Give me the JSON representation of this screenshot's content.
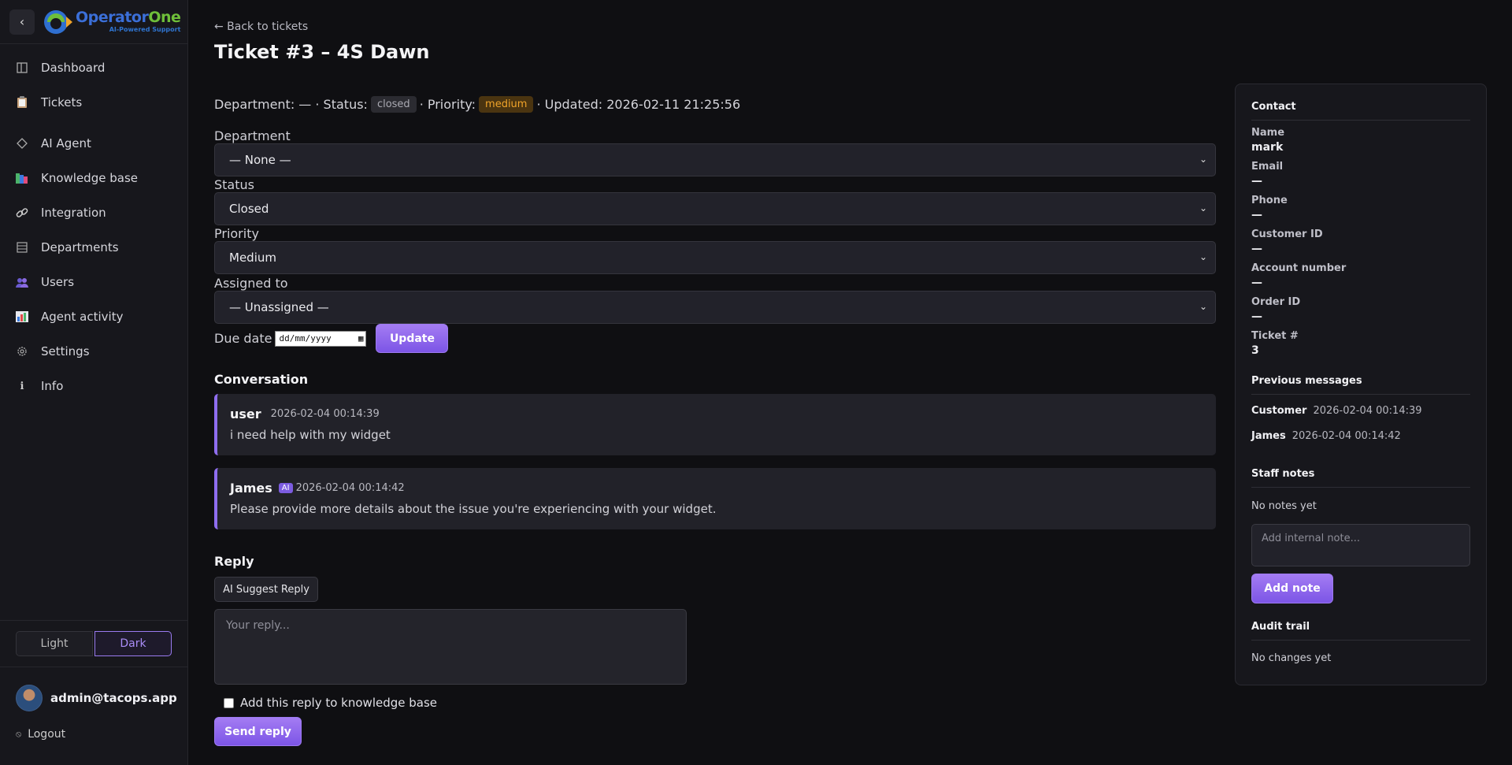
{
  "sidebar": {
    "logo_title_a": "Operator",
    "logo_title_b": "One",
    "logo_sub": "AI-Powered Support",
    "items": [
      {
        "label": "Dashboard",
        "icon": "layout-icon"
      },
      {
        "label": "Tickets",
        "icon": "clipboard-icon"
      },
      {
        "label": "AI Agent",
        "icon": "diamond-icon"
      },
      {
        "label": "Knowledge base",
        "icon": "books-icon"
      },
      {
        "label": "Integration",
        "icon": "link-icon"
      },
      {
        "label": "Departments",
        "icon": "list-icon"
      },
      {
        "label": "Users",
        "icon": "users-icon"
      },
      {
        "label": "Agent activity",
        "icon": "bar-chart-icon"
      },
      {
        "label": "Settings",
        "icon": "gear-icon"
      },
      {
        "label": "Info",
        "icon": "info-icon"
      }
    ],
    "theme_light": "Light",
    "theme_dark": "Dark",
    "user_email": "admin@tacops.app",
    "logout": "Logout"
  },
  "ticket": {
    "back": "← Back to tickets",
    "title": "Ticket #3 – 4S Dawn",
    "meta_department": "Department: — · Status:",
    "status_badge": "closed",
    "meta_priority": "· Priority:",
    "priority_badge": "medium",
    "meta_updated": "· Updated: 2026-02-11 21:25:56",
    "colors": {
      "accent": "#8f6ef0",
      "priority": "#f0a42a"
    }
  },
  "form": {
    "department_label": "Department",
    "department_value": "— None —",
    "status_label": "Status",
    "status_value": "Closed",
    "priority_label": "Priority",
    "priority_value": "Medium",
    "assigned_label": "Assigned to",
    "assigned_value": "— Unassigned —",
    "due_label": "Due date",
    "due_placeholder": "dd/mm/yyyy",
    "update_button": "Update"
  },
  "conversation": {
    "title": "Conversation",
    "messages": [
      {
        "author": "user",
        "time": "2026-02-04 00:14:39",
        "body": "i need help with my widget"
      },
      {
        "author": "James",
        "tag": "AI",
        "time": "2026-02-04 00:14:42",
        "body": "Please provide more details about the issue you're experiencing with your widget."
      }
    ]
  },
  "reply": {
    "title": "Reply",
    "ai_suggest": "AI Suggest Reply",
    "placeholder": "Your reply...",
    "kb_checkbox": "Add this reply to knowledge base",
    "send_button": "Send reply"
  },
  "contact": {
    "title": "Contact",
    "fields": [
      {
        "label": "Name",
        "value": "mark"
      },
      {
        "label": "Email",
        "value": "—"
      },
      {
        "label": "Phone",
        "value": "—"
      },
      {
        "label": "Customer ID",
        "value": "—"
      },
      {
        "label": "Account number",
        "value": "—"
      },
      {
        "label": "Order ID",
        "value": "—"
      },
      {
        "label": "Ticket #",
        "value": "3"
      }
    ],
    "prev_title": "Previous messages",
    "prev": [
      {
        "who": "Customer",
        "time": "2026-02-04 00:14:39"
      },
      {
        "who": "James",
        "time": "2026-02-04 00:14:42"
      }
    ],
    "notes_title": "Staff notes",
    "notes_empty": "No notes yet",
    "note_placeholder": "Add internal note...",
    "add_note": "Add note",
    "audit_title": "Audit trail",
    "audit_empty": "No changes yet"
  }
}
